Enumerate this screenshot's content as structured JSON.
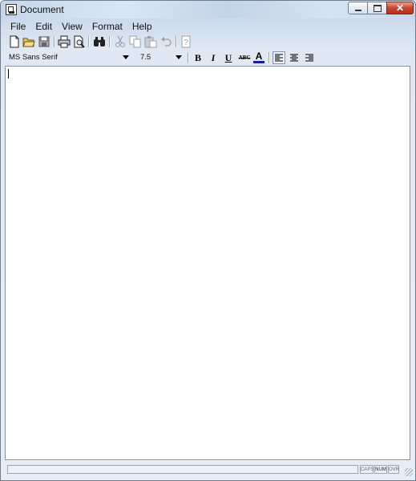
{
  "window": {
    "title": "Document"
  },
  "menu": [
    "File",
    "Edit",
    "View",
    "Format",
    "Help"
  ],
  "toolbar": {
    "buttons": [
      "new",
      "open",
      "save",
      "print",
      "print-preview",
      "find",
      "cut",
      "copy",
      "paste",
      "undo",
      "help"
    ]
  },
  "format": {
    "font_name": "MS Sans Serif",
    "font_size": "7.5",
    "bold": "B",
    "italic": "I",
    "underline": "U",
    "strike": "ABC",
    "color": "A",
    "text_color": "#1a1aa6"
  },
  "statusbar": {
    "caps": "CAPS",
    "num": "NUM",
    "ovr": "OVR"
  }
}
